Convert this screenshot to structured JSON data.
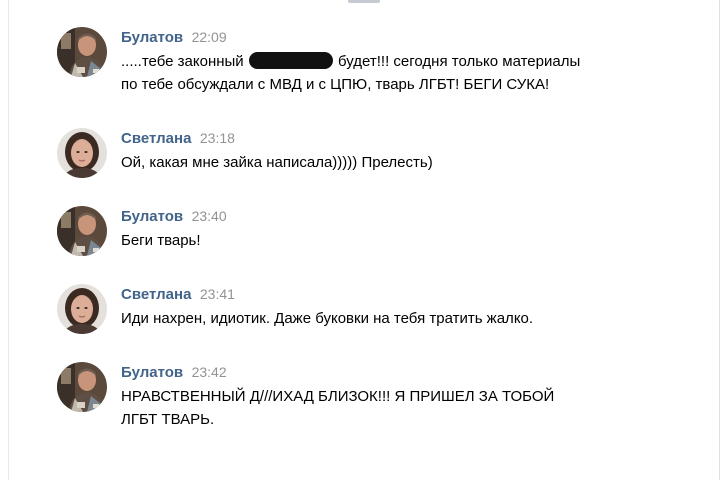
{
  "conversation": {
    "messages": [
      {
        "author": "Булатов",
        "time": "22:09",
        "avatar": "avatar-photo-man",
        "line1_before": ".....тебе законный",
        "line1_after": "будет!!! сегодня только материалы",
        "line2": "по тебе обсуждали с МВД и с ЦПЮ, тварь ЛГБТ! БЕГИ СУКА!"
      },
      {
        "author": "Светлана",
        "time": "23:18",
        "avatar": "avatar-photo-woman",
        "line1": "Ой, какая мне зайка написала))))) Прелесть)"
      },
      {
        "author": "Булатов",
        "time": "23:40",
        "avatar": "avatar-photo-man",
        "line1": "Беги тварь!"
      },
      {
        "author": "Светлана",
        "time": "23:41",
        "avatar": "avatar-photo-woman",
        "line1": "Иди нахрен, идиотик. Даже буковки на тебя тратить жалко."
      },
      {
        "author": "Булатов",
        "time": "23:42",
        "avatar": "avatar-photo-man",
        "line1": "НРАВСТВЕННЫЙ Д///ИХАД БЛИЗОК!!! Я ПРИШЕЛ ЗА ТОБОЙ",
        "line2": "ЛГБТ ТВАРЬ."
      }
    ]
  },
  "colors": {
    "author": "#42648b",
    "time": "#939393",
    "text": "#000000",
    "redaction": "#111111"
  }
}
